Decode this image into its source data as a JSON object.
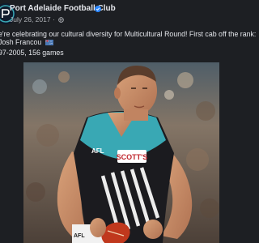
{
  "post": {
    "page_name": "Port Adelaide Football Club",
    "date": "July 26, 2017",
    "separator": "·",
    "icons": {
      "verified": "verified-badge-icon",
      "privacy": "globe-icon",
      "flag": "australian-flag-icon",
      "avatar": "club-logo"
    },
    "caption_lines": [
      "e're celebrating our cultural diversity for Multicultural Round! First cab off the rank:",
      "Josh Francou",
      "97-2005, 156 games"
    ],
    "image": {
      "description_icon": "football-player-photo",
      "jersey_sponsor": "SCOTT'S",
      "sleeve_logo": "AFL",
      "shorts_logo": "AFL"
    },
    "colors": {
      "accent_teal": "#39a8b4",
      "background": "#1d1f23",
      "verified": "#2d88ff"
    }
  }
}
